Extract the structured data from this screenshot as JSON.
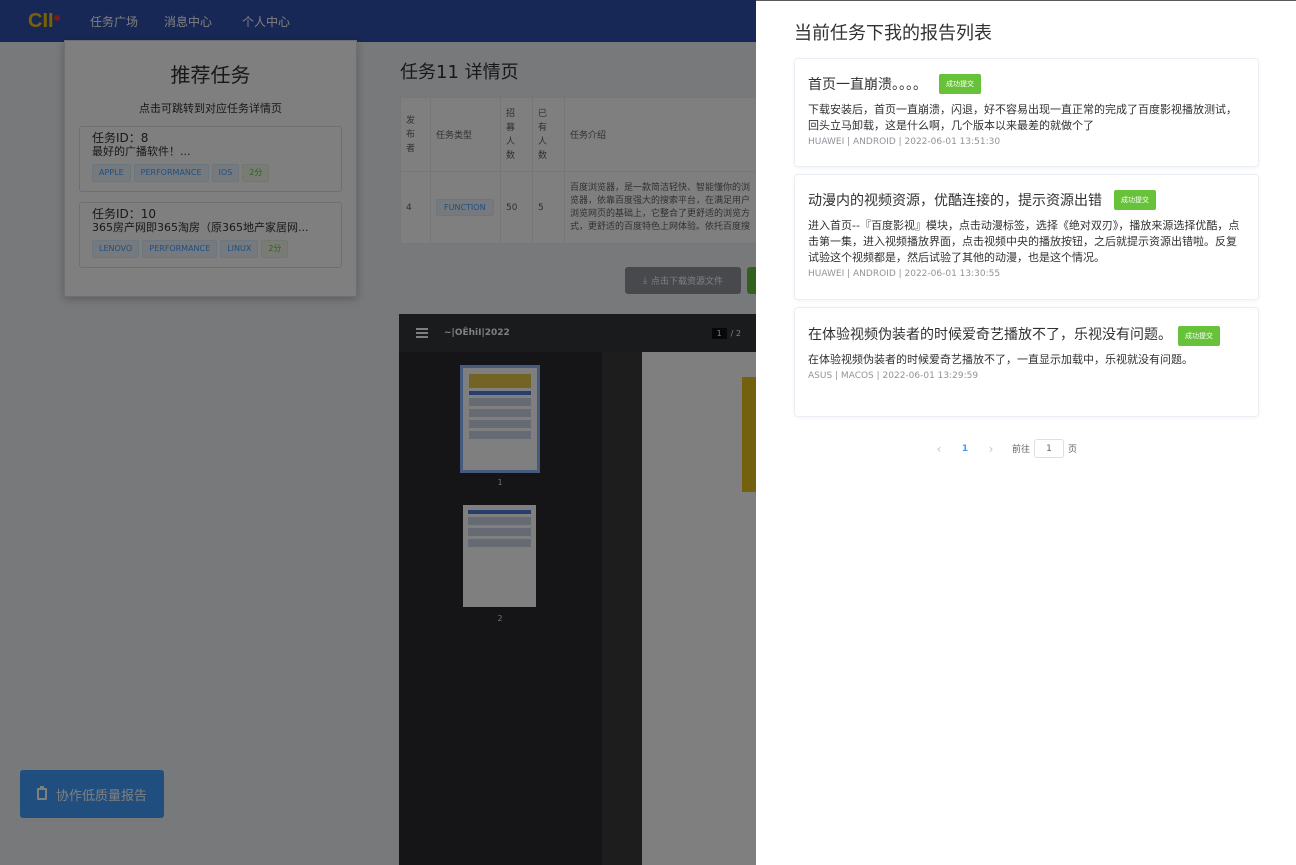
{
  "header": {
    "logo_text": "CII",
    "nav": [
      "任务广场",
      "消息中心",
      "个人中心"
    ]
  },
  "recommend": {
    "title": "推荐任务",
    "subtitle": "点击可跳转到对应任务详情页",
    "tasks": [
      {
        "id_label": "任务ID：8",
        "desc": "最好的广播软件！...",
        "tags": [
          "APPLE",
          "PERFORMANCE",
          "IOS"
        ],
        "points": "2分"
      },
      {
        "id_label": "任务ID：10",
        "desc": "365房产网即365淘房（原365地产家居网...",
        "tags": [
          "LENOVO",
          "PERFORMANCE",
          "LINUX"
        ],
        "points": "2分"
      }
    ]
  },
  "detail": {
    "title": "任务11 详情页",
    "columns": [
      "发布者",
      "任务类型",
      "招募人数",
      "已有人数",
      "任务介绍"
    ],
    "row": {
      "publisher": "4",
      "type": "FUNCTION",
      "recruit": "50",
      "current": "5",
      "intro": "百度浏览器，是一款简洁轻快、智能懂你的浏览器，依靠百度强大的搜索平台，在满足用户浏览网页的基础上，它整合了更舒适的浏览方式，更舒适的百度特色上网体验。依托百度搜索，以其强大的功能、超快的浏览速度、丰富的内容逐渐成为国内成长最快的手机浏览器之一，满足用户看新闻、听音乐、视频、游戏等个性娱乐诉求。"
    },
    "download_label": "点击下载资源文件"
  },
  "pdf": {
    "filename": "~|OÊhiI|2022",
    "page_current": "1",
    "page_total": "/ 2",
    "thumb_labels": [
      "1",
      "2"
    ]
  },
  "float_button": "协作低质量报告",
  "drawer": {
    "title": "当前任务下我的报告列表",
    "reports": [
      {
        "title": "首页一直崩溃。。。。",
        "status": "成功提交",
        "body": "下载安装后，首页一直崩溃，闪退，好不容易出现一直正常的完成了百度影视播放测试，回头立马卸载，这是什么啊，几个版本以来最差的就做个了",
        "meta": "HUAWEI | ANDROID | 2022-06-01 13:51:30"
      },
      {
        "title": "动漫内的视频资源，优酷连接的，提示资源出错",
        "status": "成功提交",
        "body": "进入首页--『百度影视』模块，点击动漫标签，选择《绝对双刃》，播放来源选择优酷，点击第一集，进入视频播放界面，点击视频中央的播放按钮，之后就提示资源出错啦。反复试验这个视频都是，然后试验了其他的动漫，也是这个情况。",
        "meta": "HUAWEI | ANDROID | 2022-06-01 13:30:55"
      },
      {
        "title": "在体验视频伪装者的时候爱奇艺播放不了，乐视没有问题。",
        "status": "成功提交",
        "body": "在体验视频伪装者的时候爱奇艺播放不了，一直显示加载中，乐视就没有问题。",
        "meta": "ASUS | MACOS | 2022-06-01 13:29:59"
      }
    ],
    "pagination": {
      "prev": "‹",
      "current": "1",
      "next": "›",
      "goto_label": "前往",
      "goto_value": "1",
      "page_suffix": "页"
    }
  }
}
